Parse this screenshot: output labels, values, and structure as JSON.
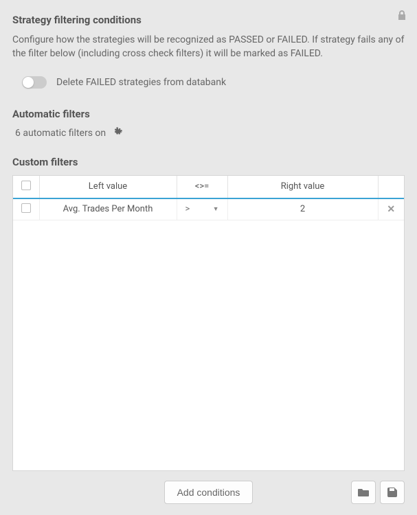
{
  "header": {
    "title": "Strategy filtering conditions",
    "description": "Configure how the strategies will be recognized as PASSED or FAILED. If strategy fails any of the filter below (including cross check filters) it will be marked as FAILED."
  },
  "toggle": {
    "label": "Delete FAILED strategies from databank",
    "state": false
  },
  "automatic_filters": {
    "title": "Automatic filters",
    "status": "6 automatic filters on"
  },
  "custom_filters": {
    "title": "Custom filters",
    "columns": {
      "left": "Left value",
      "op": "<>=",
      "right": "Right value"
    },
    "rows": [
      {
        "checked": false,
        "left": "Avg. Trades Per Month",
        "op": ">",
        "right": "2"
      }
    ]
  },
  "footer": {
    "add_button": "Add conditions"
  }
}
